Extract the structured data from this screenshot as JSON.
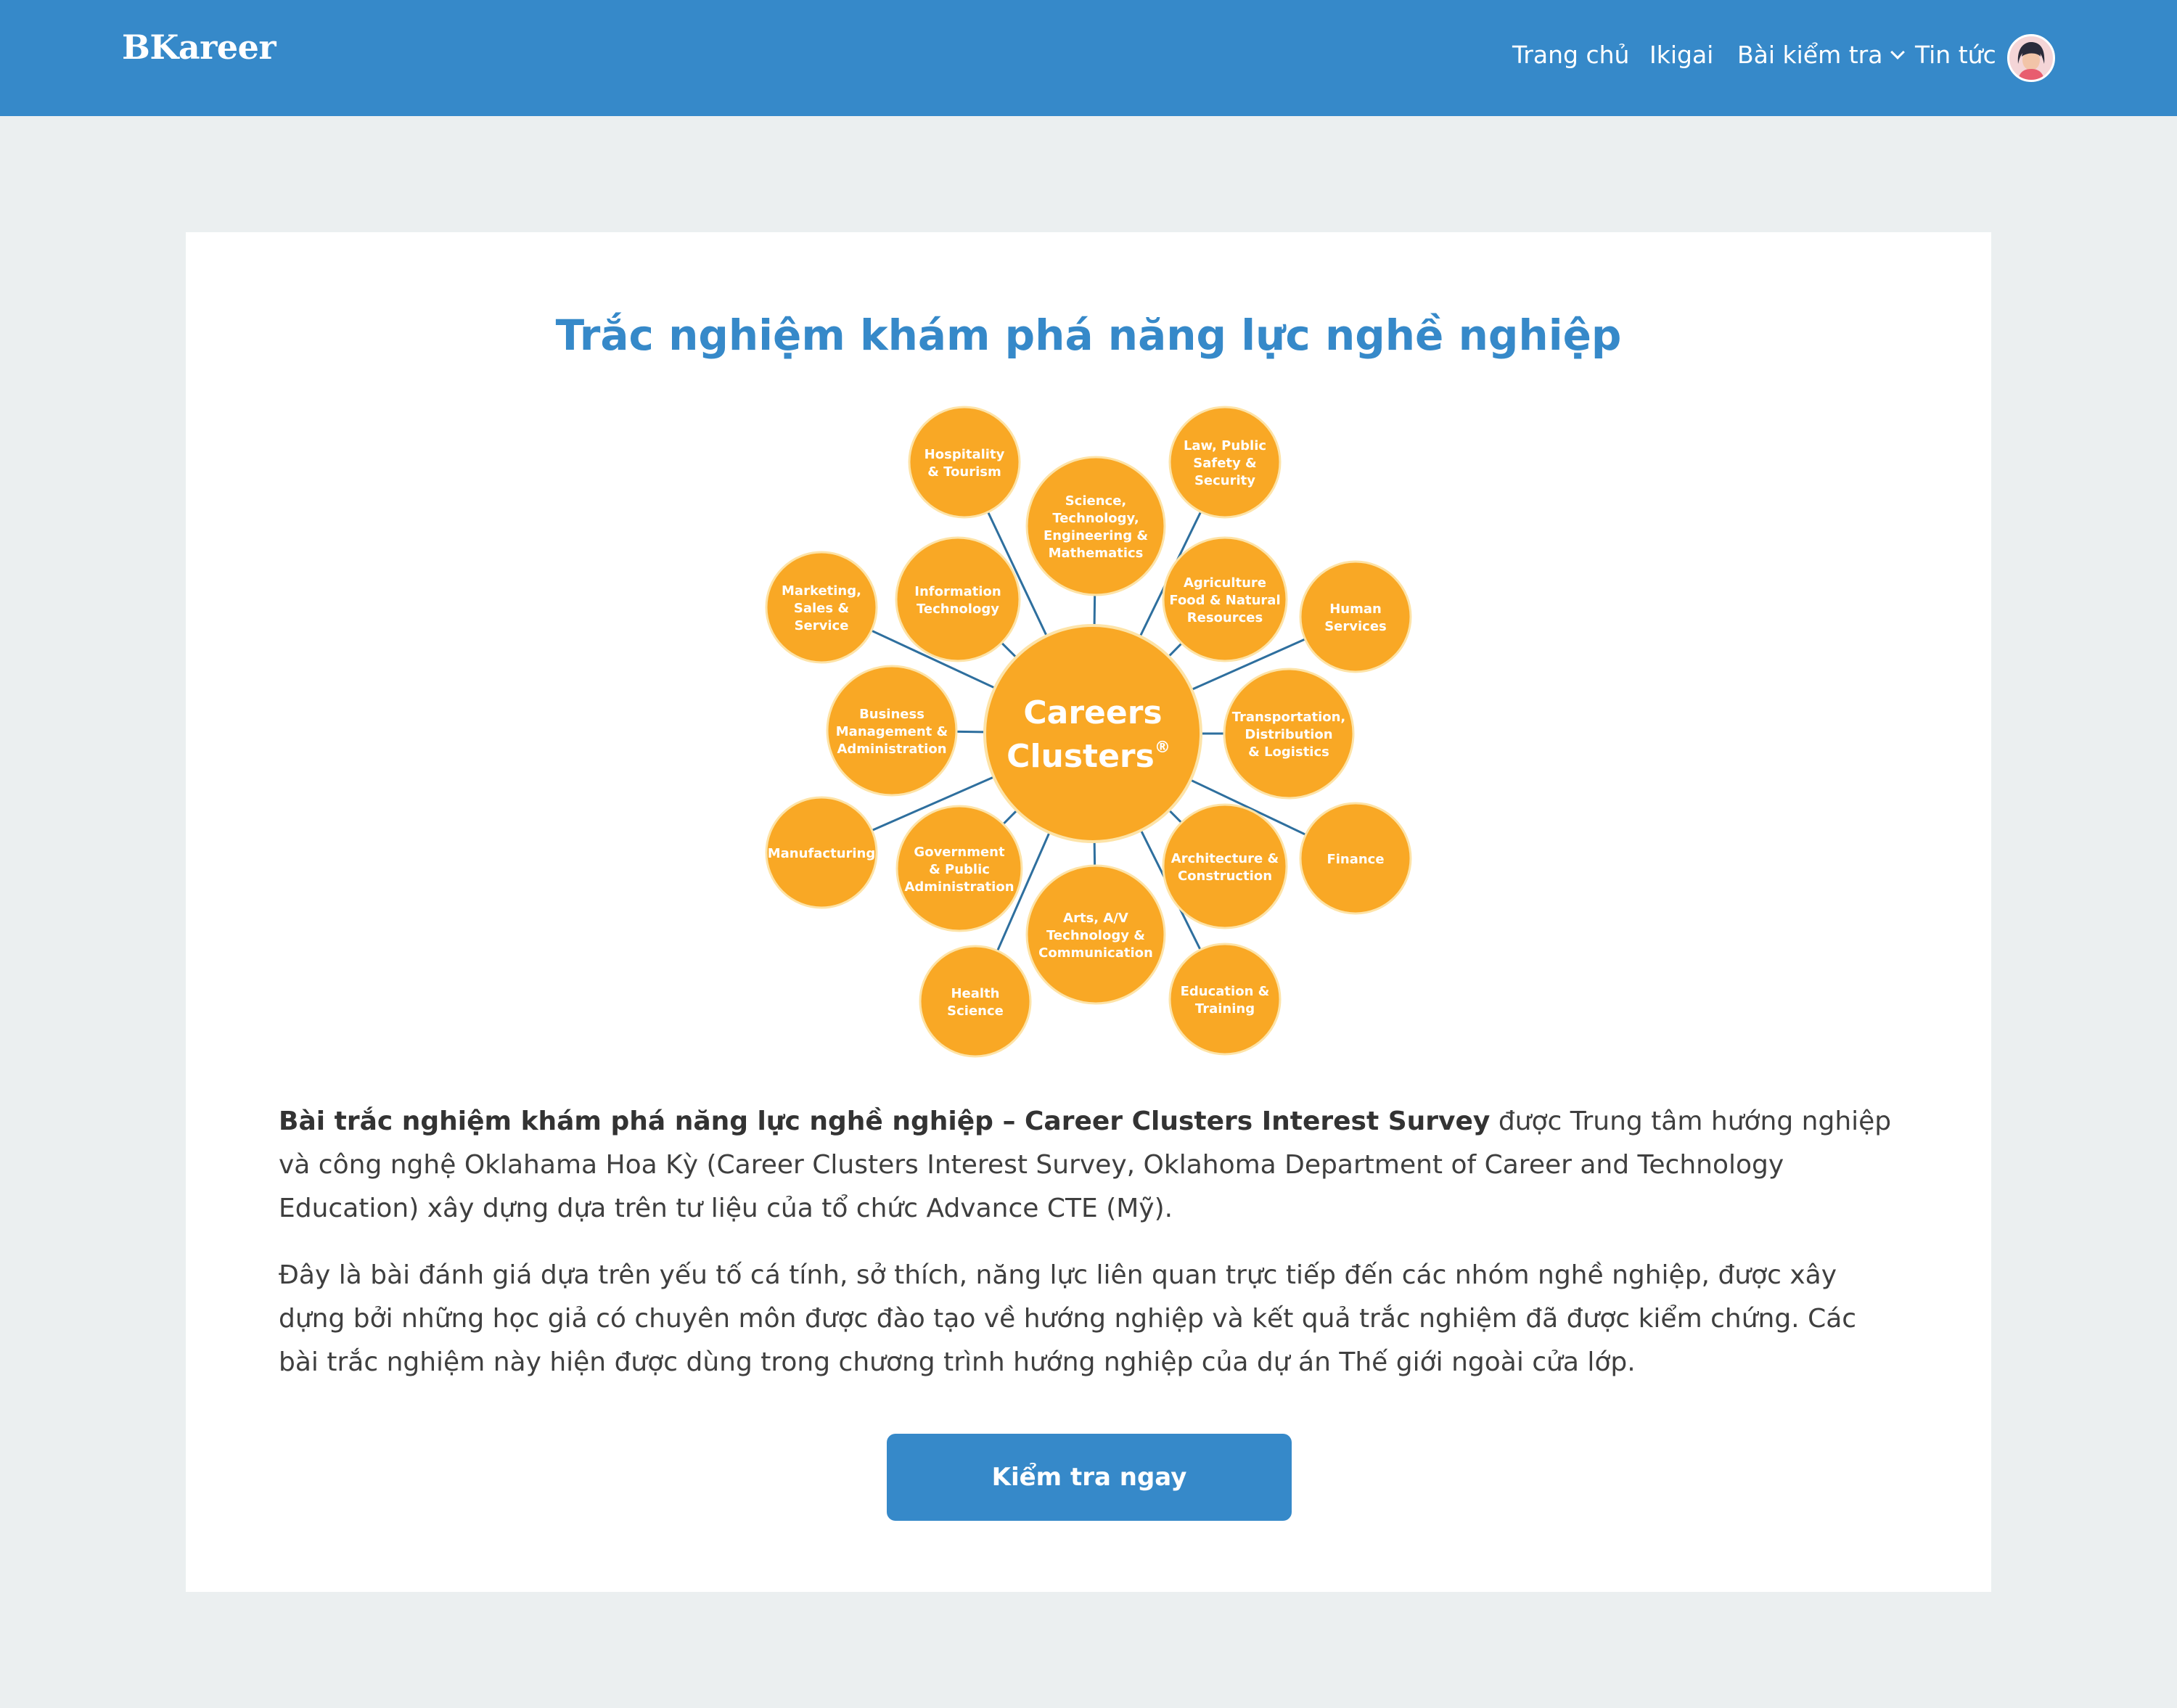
{
  "navbar": {
    "brand": "BKareer",
    "items": [
      {
        "label": "Trang chủ"
      },
      {
        "label": "Ikigai"
      },
      {
        "label": "Bài kiểm tra"
      },
      {
        "label": "Tin tức"
      }
    ]
  },
  "main": {
    "title": "Trắc nghiệm khám phá năng lực nghề nghiệp",
    "diagram": {
      "center": [
        "Careers",
        "Clusters"
      ],
      "center_mark": "®",
      "clusters": [
        [
          "Hospitality",
          "& Tourism"
        ],
        [
          "Science,",
          "Technology,",
          "Engineering &",
          "Mathematics"
        ],
        [
          "Law, Public",
          "Safety &",
          "Security"
        ],
        [
          "Marketing,",
          "Sales &",
          "Service"
        ],
        [
          "Information",
          "Technology"
        ],
        [
          "Agriculture",
          "Food & Natural",
          "Resources"
        ],
        [
          "Human",
          "Services"
        ],
        [
          "Business",
          "Management &",
          "Administration"
        ],
        [
          "Transportation,",
          "Distribution",
          "& Logistics"
        ],
        [
          "Manufacturing"
        ],
        [
          "Government",
          "& Public",
          "Administration"
        ],
        [
          "Architecture &",
          "Construction"
        ],
        [
          "Finance"
        ],
        [
          "Arts, A/V",
          "Technology &",
          "Communication"
        ],
        [
          "Health",
          "Science"
        ],
        [
          "Education &",
          "Training"
        ]
      ]
    },
    "intro_bold": "Bài trắc nghiệm khám phá năng lực nghề nghiệp – Career Clusters Interest Survey",
    "intro_rest": " được Trung tâm hướng nghiệp và công nghệ Oklahama Hoa Kỳ (Career Clusters Interest Survey, Oklahoma Department of Career and Technology Education) xây dựng dựa trên tư liệu của tổ chức Advance CTE (Mỹ).",
    "paragraph2": "Đây là bài đánh giá dựa trên yếu tố cá tính, sở thích, năng lực liên quan trực tiếp đến các nhóm nghề nghiệp, được xây dựng bởi những học giả có chuyên môn được đào tạo về hướng nghiệp và kết quả trắc nghiệm đã được kiểm chứng. Các bài trắc nghiệm này hiện được dùng trong chương trình hướng nghiệp của dự án Thế giới ngoài cửa lớp.",
    "cta_label": "Kiểm tra ngay"
  },
  "colors": {
    "navbar": "#3689c9",
    "page_bg": "#ebeff0",
    "bubble": "#f9a825",
    "connector": "#2e6f9e",
    "text": "#3f3f3f"
  }
}
